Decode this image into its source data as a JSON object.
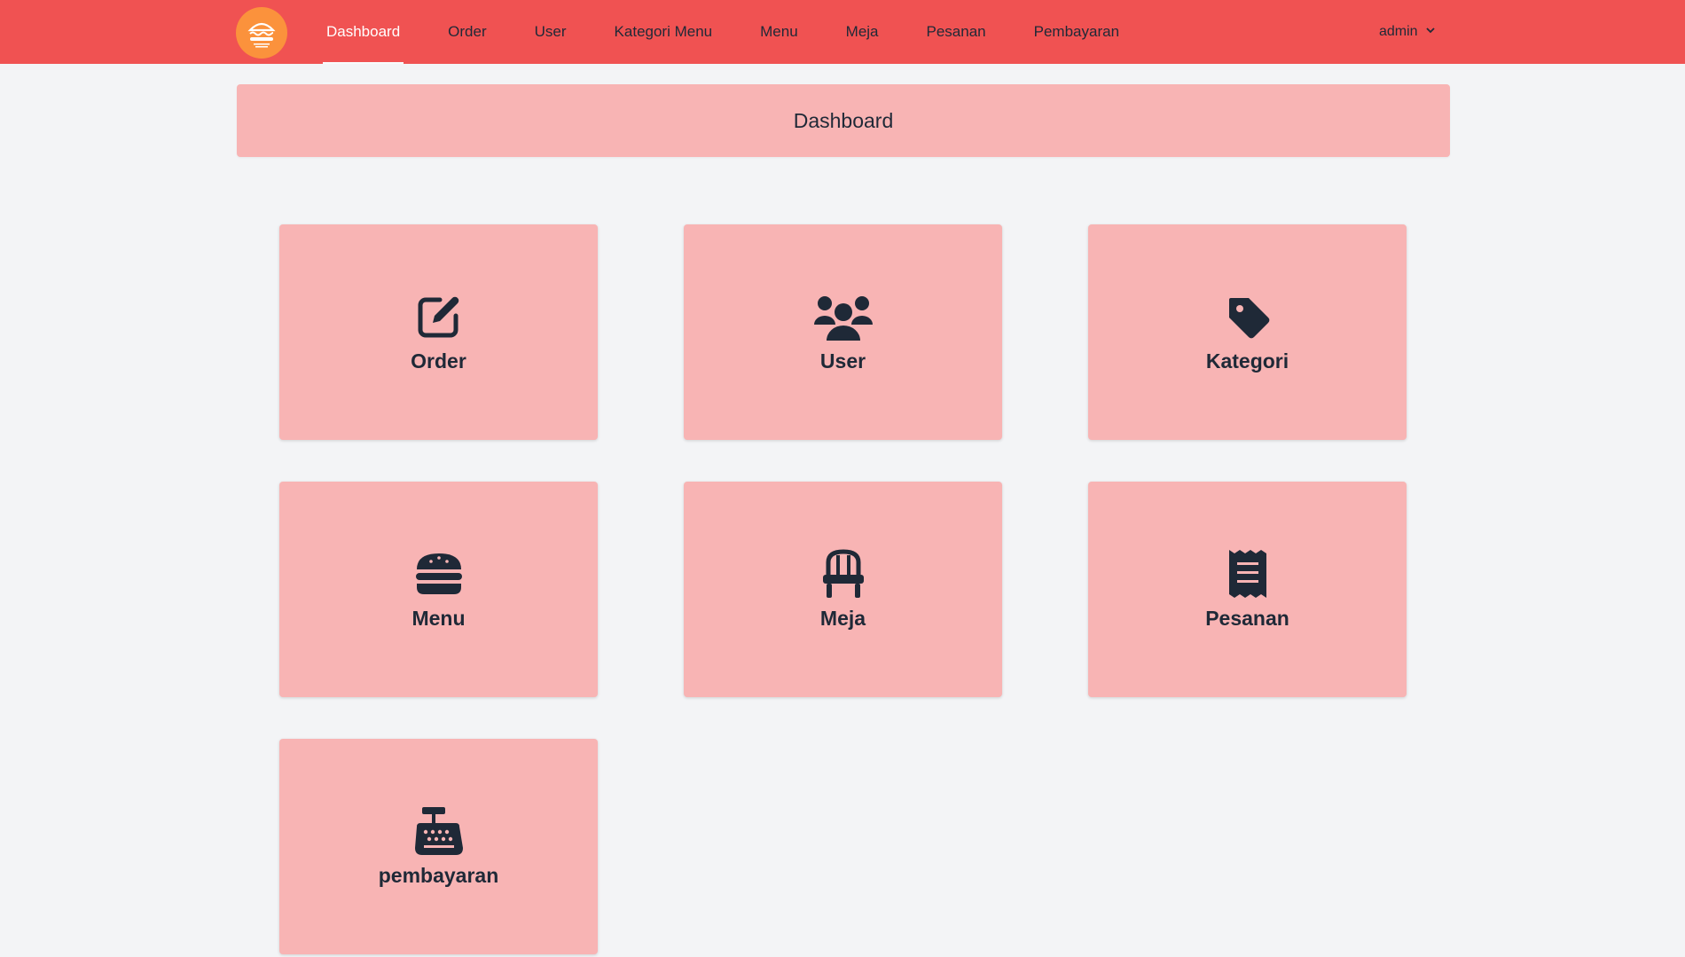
{
  "nav": {
    "logo_icon": "burger-logo-icon",
    "links": [
      {
        "label": "Dashboard",
        "active": true
      },
      {
        "label": "Order"
      },
      {
        "label": "User"
      },
      {
        "label": "Kategori Menu"
      },
      {
        "label": "Menu"
      },
      {
        "label": "Meja"
      },
      {
        "label": "Pesanan"
      },
      {
        "label": "Pembayaran"
      }
    ],
    "user": {
      "label": "admin",
      "icon": "chevron-down-icon"
    }
  },
  "header": {
    "title": "Dashboard"
  },
  "cards": [
    {
      "label": "Order",
      "icon": "edit-icon"
    },
    {
      "label": "User",
      "icon": "users-icon"
    },
    {
      "label": "Kategori",
      "icon": "tag-icon"
    },
    {
      "label": "Menu",
      "icon": "burger-icon"
    },
    {
      "label": "Meja",
      "icon": "chair-icon"
    },
    {
      "label": "Pesanan",
      "icon": "receipt-icon"
    },
    {
      "label": "pembayaran",
      "icon": "cash-register-icon"
    }
  ],
  "colors": {
    "navbar": "#f05252",
    "card": "#f8b4b4",
    "background": "#f3f4f6",
    "icon": "#1f2937",
    "logo": "#fb923c"
  }
}
